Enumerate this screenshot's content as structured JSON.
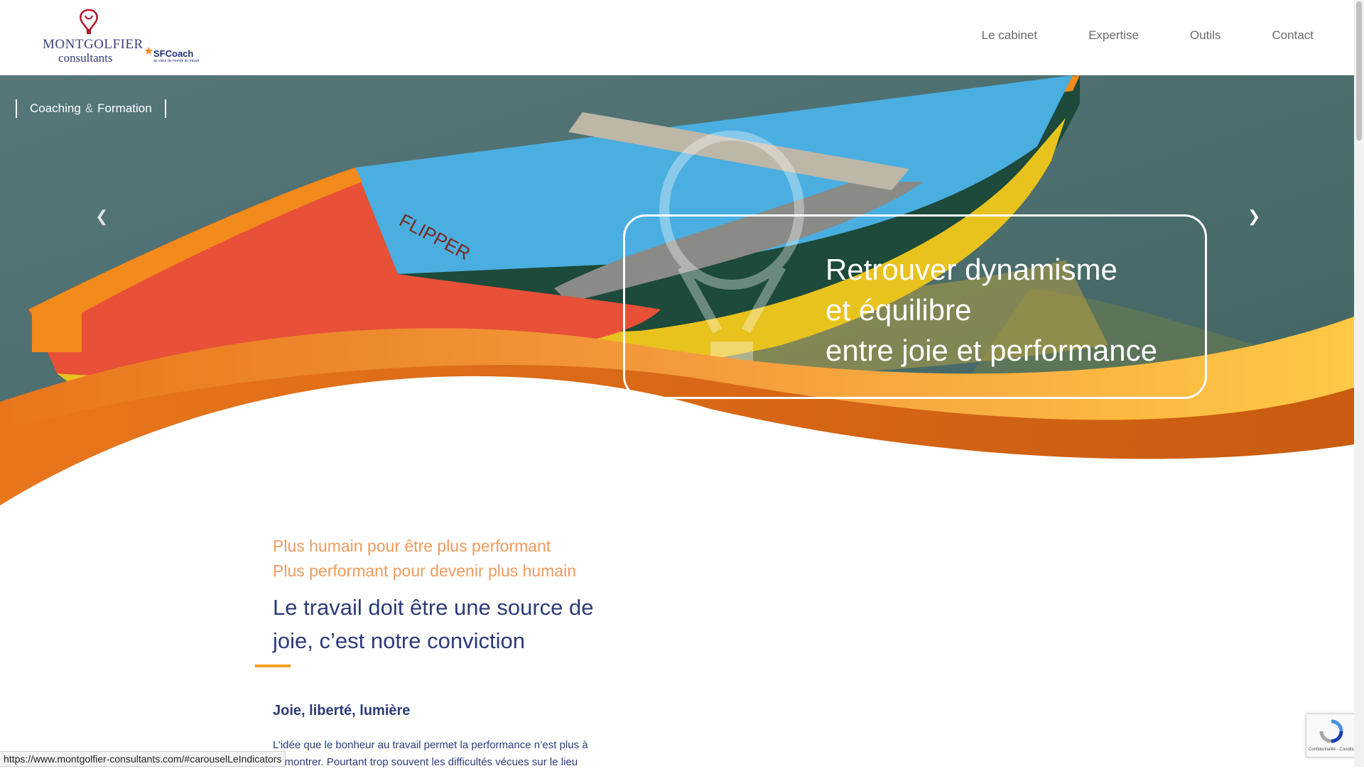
{
  "header": {
    "logo_brand": "MONTGOLFIER",
    "logo_sub": "consultants",
    "partner_logo": "SFCoach",
    "partner_tagline": "au cœur du monde du travail",
    "nav": [
      {
        "label": "Le cabinet"
      },
      {
        "label": "Expertise"
      },
      {
        "label": "Outils"
      },
      {
        "label": "Contact"
      }
    ]
  },
  "hero": {
    "badge_left": "Coaching",
    "badge_amp": "&",
    "badge_right": "Formation",
    "caption_lines": [
      "Retrouver dynamisme",
      "et équilibre",
      "entre joie et performance"
    ],
    "prev_icon": "chevron-left-icon",
    "next_icon": "chevron-right-icon",
    "boat_name": "FLIPPER"
  },
  "main": {
    "tagline1": "Plus humain pour être plus performant",
    "tagline2": "Plus performant pour devenir plus humain",
    "headline": "Le travail doit être une source de joie, c’est notre conviction",
    "section_title": "Joie, liberté, lumière",
    "paragraph": "L’idée que le bonheur au travail permet la performance n’est plus à démontrer. Pourtant trop souvent les difficultés vécues sur le lieu"
  },
  "status_bar": {
    "url": "https://www.montgolfier-consultants.com/#carouselLeIndicators"
  },
  "recaptcha": {
    "label": "Confidentialité - Conditions"
  },
  "colors": {
    "accent_orange": "#f29a5c",
    "brand_navy": "#2d3a7a",
    "wave_orange": "#e8761c",
    "wave_yellow": "#ffc845"
  }
}
